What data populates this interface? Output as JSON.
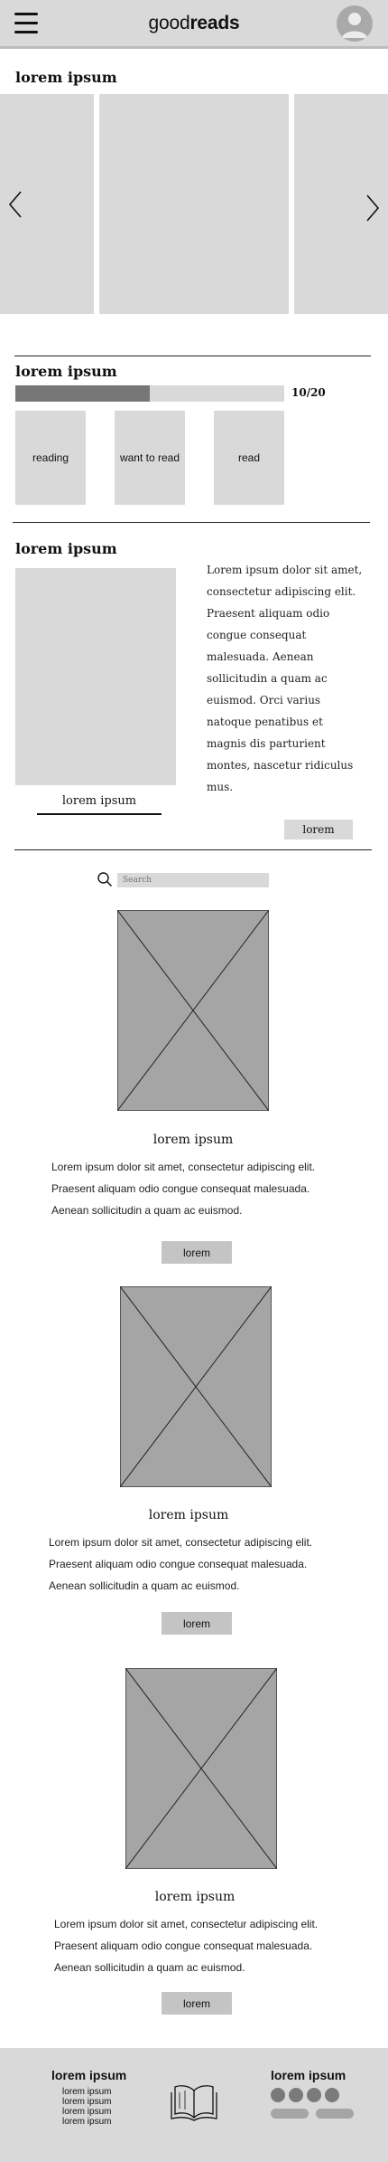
{
  "header": {
    "logo_light": "good",
    "logo_bold": "reads",
    "menu_icon": "hamburger-menu-icon",
    "avatar_icon": "user-avatar-icon"
  },
  "carousel": {
    "title": "lorem ipsum",
    "prev_icon": "chevron-left-icon",
    "next_icon": "chevron-right-icon"
  },
  "progress": {
    "title": "lorem ipsum",
    "current": 10,
    "total": 20,
    "label": "10/20",
    "shelves": [
      "reading",
      "want to read",
      "read"
    ]
  },
  "featured": {
    "title": "lorem ipsum",
    "caption": "lorem ipsum",
    "lines": [
      "Lorem ipsum dolor sit amet,",
      "consectetur adipiscing elit.",
      "Praesent aliquam odio",
      "congue consequat",
      "malesuada. Aenean",
      "sollicitudin a quam ac",
      "euismod. Orci varius",
      "natoque penatibus et",
      "magnis dis parturient",
      "montes, nascetur ridiculus",
      "mus."
    ],
    "button": "lorem"
  },
  "search": {
    "placeholder": "Search",
    "icon": "search-icon"
  },
  "books": [
    {
      "title": "lorem ipsum",
      "lines": [
        "Lorem ipsum dolor sit amet, consectetur adipiscing elit.",
        "Praesent aliquam odio congue consequat malesuada.",
        "Aenean sollicitudin a quam ac euismod."
      ],
      "button": "lorem"
    },
    {
      "title": "lorem ipsum",
      "lines": [
        "Lorem ipsum dolor sit amet, consectetur adipiscing elit.",
        "Praesent aliquam odio congue consequat malesuada.",
        "Aenean sollicitudin a quam ac euismod."
      ],
      "button": "lorem"
    },
    {
      "title": "lorem ipsum",
      "lines": [
        "Lorem ipsum dolor sit amet, consectetur adipiscing elit.",
        "Praesent aliquam odio congue consequat malesuada.",
        "Aenean sollicitudin a quam ac euismod."
      ],
      "button": "lorem"
    }
  ],
  "footer": {
    "left_title": "lorem ipsum",
    "links": [
      "lorem ipsum",
      "lorem ipsum",
      "lorem ipsum",
      "lorem ipsum"
    ],
    "center_icon": "open-book-icon",
    "right_title": "lorem ipsum",
    "social_icons": [
      "social-icon",
      "social-icon",
      "social-icon",
      "social-icon"
    ]
  },
  "colors": {
    "header_bg": "#d9d9d9",
    "placeholder": "#d9d9d9",
    "image_placeholder": "#a5a5a5",
    "progress_fill": "#777777",
    "button": "#c4c4c4"
  }
}
